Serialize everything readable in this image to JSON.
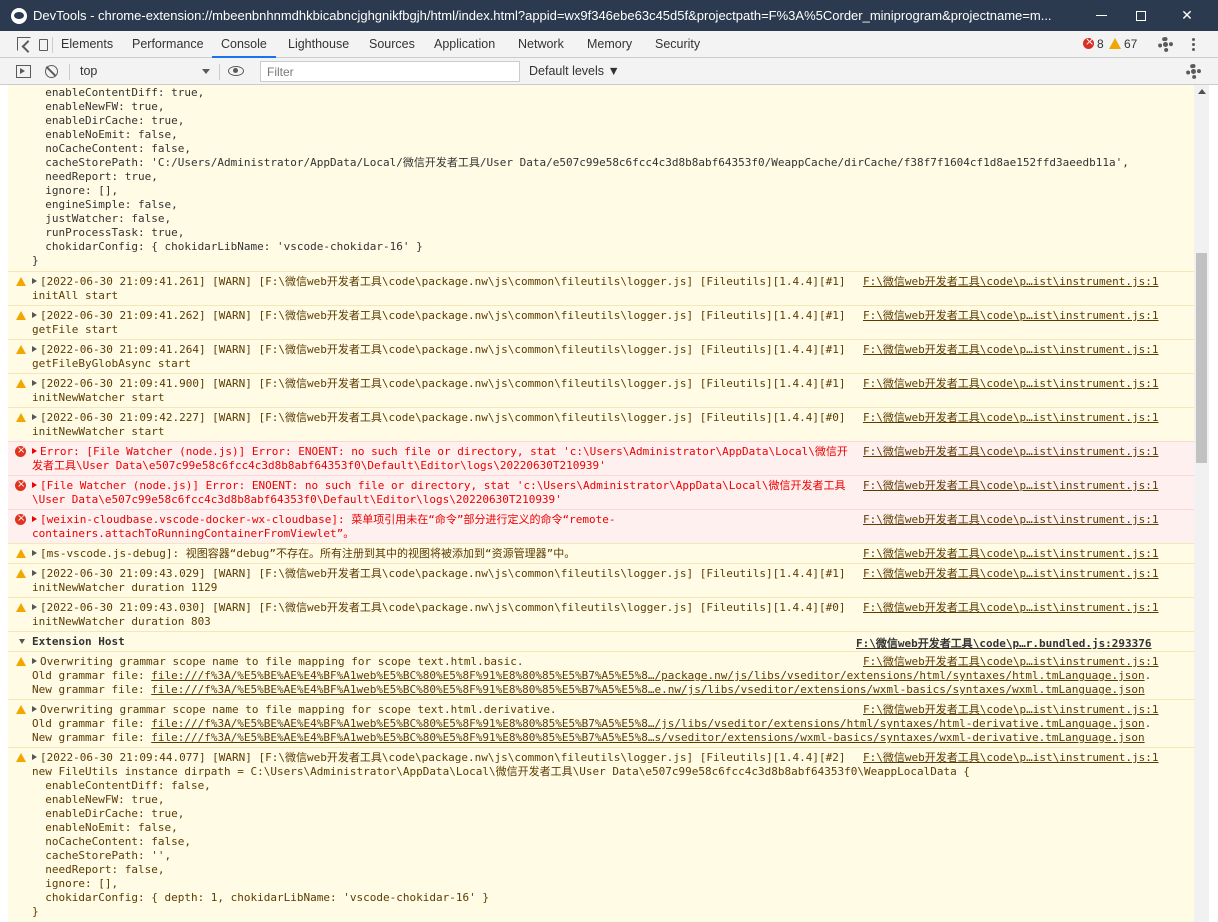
{
  "window": {
    "title": "DevTools - chrome-extension://mbeenbnhnmdhkbicabncjghgnikfbgjh/html/index.html?appid=wx9f346ebe63c45d5f&projectpath=F%3A%5Corder_miniprogram&projectname=m...",
    "controls": [
      "minimize",
      "maximize",
      "close"
    ]
  },
  "tabs": [
    "Elements",
    "Performance",
    "Console",
    "Lighthouse",
    "Sources",
    "Application",
    "Network",
    "Memory",
    "Security"
  ],
  "active_tab": "Console",
  "counts": {
    "errors": "8",
    "warnings": "67"
  },
  "toolbar": {
    "context": "top",
    "filter_placeholder": "Filter",
    "levels": "Default levels ▼"
  },
  "console": {
    "top_block": "  enableContentDiff: true,\n  enableNewFW: true,\n  enableDirCache: true,\n  enableNoEmit: false,\n  noCacheContent: false,\n  cacheStorePath: 'C:/Users/Administrator/AppData/Local/微信开发者工具/User Data/e507c99e58c6fcc4c3d8b8abf64353f0/WeappCache/dirCache/f38f7f1604cf1d8ae152ffd3aeedb11a',\n  needReport: true,\n  ignore: [],\n  engineSimple: false,\n  justWatcher: false,\n  runProcessTask: true,\n  chokidarConfig: { chokidarLibName: 'vscode-chokidar-16' }\n}",
    "messages": [
      {
        "level": "warn",
        "line1": "[2022-06-30 21:09:41.261] [WARN] [F:\\微信web开发者工具\\code\\package.nw\\js\\common\\fileutils\\logger.js] [Fileutils][1.4.4][#1]",
        "line2": "initAll start",
        "src": "F:\\微信web开发者工具\\code\\p…ist\\instrument.js:1"
      },
      {
        "level": "warn",
        "line1": "[2022-06-30 21:09:41.262] [WARN] [F:\\微信web开发者工具\\code\\package.nw\\js\\common\\fileutils\\logger.js] [Fileutils][1.4.4][#1]",
        "line2": "getFile start",
        "src": "F:\\微信web开发者工具\\code\\p…ist\\instrument.js:1"
      },
      {
        "level": "warn",
        "line1": "[2022-06-30 21:09:41.264] [WARN] [F:\\微信web开发者工具\\code\\package.nw\\js\\common\\fileutils\\logger.js] [Fileutils][1.4.4][#1]",
        "line2": "getFileByGlobAsync start",
        "src": "F:\\微信web开发者工具\\code\\p…ist\\instrument.js:1"
      },
      {
        "level": "warn",
        "line1": "[2022-06-30 21:09:41.900] [WARN] [F:\\微信web开发者工具\\code\\package.nw\\js\\common\\fileutils\\logger.js] [Fileutils][1.4.4][#1]",
        "line2": "initNewWatcher start",
        "src": "F:\\微信web开发者工具\\code\\p…ist\\instrument.js:1"
      },
      {
        "level": "warn",
        "line1": "[2022-06-30 21:09:42.227] [WARN] [F:\\微信web开发者工具\\code\\package.nw\\js\\common\\fileutils\\logger.js] [Fileutils][1.4.4][#0]",
        "line2": "initNewWatcher start",
        "src": "F:\\微信web开发者工具\\code\\p…ist\\instrument.js:1"
      },
      {
        "level": "error",
        "line1": "Error: [File Watcher (node.js)] Error: ENOENT: no such file or directory, stat 'c:\\Users\\Administrator\\AppData\\Local\\微信开",
        "line2": "发者工具\\User Data\\e507c99e58c6fcc4c3d8b8abf64353f0\\Default\\Editor\\logs\\20220630T210939'",
        "src": "F:\\微信web开发者工具\\code\\p…ist\\instrument.js:1"
      },
      {
        "level": "error",
        "line1": "[File Watcher (node.js)] Error: ENOENT: no such file or directory, stat 'c:\\Users\\Administrator\\AppData\\Local\\微信开发者工具",
        "line2": "\\User Data\\e507c99e58c6fcc4c3d8b8abf64353f0\\Default\\Editor\\logs\\20220630T210939'",
        "src": "F:\\微信web开发者工具\\code\\p…ist\\instrument.js:1"
      },
      {
        "level": "error",
        "line1": "[weixin-cloudbase.vscode-docker-wx-cloudbase]: 菜单项引用未在“命令”部分进行定义的命令“remote-",
        "line2": "containers.attachToRunningContainerFromViewlet”。",
        "src": "F:\\微信web开发者工具\\code\\p…ist\\instrument.js:1"
      },
      {
        "level": "warn",
        "line1": "[ms-vscode.js-debug]: 视图容器“debug”不存在。所有注册到其中的视图将被添加到“资源管理器”中。",
        "line2": "",
        "src": "F:\\微信web开发者工具\\code\\p…ist\\instrument.js:1"
      },
      {
        "level": "warn",
        "line1": "[2022-06-30 21:09:43.029] [WARN] [F:\\微信web开发者工具\\code\\package.nw\\js\\common\\fileutils\\logger.js] [Fileutils][1.4.4][#1]",
        "line2": "initNewWatcher duration 1129",
        "src": "F:\\微信web开发者工具\\code\\p…ist\\instrument.js:1"
      },
      {
        "level": "warn",
        "line1": "[2022-06-30 21:09:43.030] [WARN] [F:\\微信web开发者工具\\code\\package.nw\\js\\common\\fileutils\\logger.js] [Fileutils][1.4.4][#0]",
        "line2": "initNewWatcher duration 803",
        "src": "F:\\微信web开发者工具\\code\\p…ist\\instrument.js:1"
      }
    ],
    "group": {
      "title": "Extension Host",
      "src": "F:\\微信web开发者工具\\code\\p…r.bundled.js:293376"
    },
    "group_messages": [
      {
        "line1": "Overwriting grammar scope name to file mapping for scope text.html.basic.",
        "src": "F:\\微信web开发者工具\\code\\p…ist\\instrument.js:1",
        "l2_label": "Old grammar file: ",
        "l2_link": "file:///f%3A/%E5%BE%AE%E4%BF%A1web%E5%BC%80%E5%8F%91%E8%80%85%E5%B7%A5%E5%8…/package.nw/js/libs/vseditor/extensions/html/syntaxes/html.tmLanguage.json",
        "l2_tail": ".",
        "l3_label": "New grammar file: ",
        "l3_link": "file:///f%3A/%E5%BE%AE%E4%BF%A1web%E5%BC%80%E5%8F%91%E8%80%85%E5%B7%A5%E5%8…e.nw/js/libs/vseditor/extensions/wxml-basics/syntaxes/wxml.tmLanguage.json"
      },
      {
        "line1": "Overwriting grammar scope name to file mapping for scope text.html.derivative.",
        "src": "F:\\微信web开发者工具\\code\\p…ist\\instrument.js:1",
        "l2_label": "Old grammar file: ",
        "l2_link": "file:///f%3A/%E5%BE%AE%E4%BF%A1web%E5%BC%80%E5%8F%91%E8%80%85%E5%B7%A5%E5%8…/js/libs/vseditor/extensions/html/syntaxes/html-derivative.tmLanguage.json",
        "l2_tail": ".",
        "l3_label": "New grammar file: ",
        "l3_link": "file:///f%3A/%E5%BE%AE%E4%BF%A1web%E5%BC%80%E5%8F%91%E8%80%85%E5%B7%A5%E5%8…s/vseditor/extensions/wxml-basics/syntaxes/wxml-derivative.tmLanguage.json"
      }
    ],
    "last_message": {
      "line1": "[2022-06-30 21:09:44.077] [WARN] [F:\\微信web开发者工具\\code\\package.nw\\js\\common\\fileutils\\logger.js] [Fileutils][1.4.4][#2]",
      "src": "F:\\微信web开发者工具\\code\\p…ist\\instrument.js:1",
      "body": "new FileUtils instance dirpath = C:\\Users\\Administrator\\AppData\\Local\\微信开发者工具\\User Data\\e507c99e58c6fcc4c3d8b8abf64353f0\\WeappLocalData {\n  enableContentDiff: false,\n  enableNewFW: true,\n  enableDirCache: true,\n  enableNoEmit: false,\n  noCacheContent: false,\n  cacheStorePath: '',\n  needReport: false,\n  ignore: [],\n  chokidarConfig: { depth: 1, chokidarLibName: 'vscode-chokidar-16' }\n}"
    }
  }
}
